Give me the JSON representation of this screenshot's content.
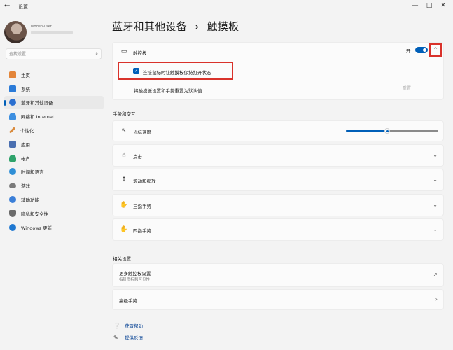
{
  "window": {
    "title": "设置",
    "back_glyph": "←",
    "min_glyph": "—",
    "max_glyph": "□",
    "close_glyph": "✕"
  },
  "profile": {
    "name": "hidden-user"
  },
  "search": {
    "placeholder": "查找设置",
    "icon": "search-icon"
  },
  "sidebar": {
    "active_index": 2,
    "items": [
      {
        "label": "主页",
        "icon": "home-icon",
        "color": "#e3853a"
      },
      {
        "label": "系统",
        "icon": "monitor-icon",
        "color": "#2b7bd8"
      },
      {
        "label": "蓝牙和其他设备",
        "icon": "bluetooth-icon",
        "color": "#2a6fd0"
      },
      {
        "label": "网络和 Internet",
        "icon": "wifi-icon",
        "color": "#3d8fe0"
      },
      {
        "label": "个性化",
        "icon": "brush-icon",
        "color": "#d98a3c"
      },
      {
        "label": "应用",
        "icon": "apps-icon",
        "color": "#4a6fb0"
      },
      {
        "label": "帐户",
        "icon": "person-icon",
        "color": "#2fa36b"
      },
      {
        "label": "时间和语言",
        "icon": "globe-clock-icon",
        "color": "#2f8fd6"
      },
      {
        "label": "游戏",
        "icon": "gamepad-icon",
        "color": "#7a7a7a"
      },
      {
        "label": "辅助功能",
        "icon": "accessibility-icon",
        "color": "#3b7fd8"
      },
      {
        "label": "隐私和安全性",
        "icon": "shield-icon",
        "color": "#6b6b6b"
      },
      {
        "label": "Windows 更新",
        "icon": "update-icon",
        "color": "#1f78d1"
      }
    ]
  },
  "header": {
    "breadcrumb_parent": "蓝牙和其他设备",
    "separator": "›",
    "title": "触摸板"
  },
  "touchpad": {
    "label": "触控板",
    "toggle_state_label": "开",
    "toggle_on": true,
    "collapse_glyph": "^",
    "checkbox_label": "连接鼠标时让触摸板保持打开状态",
    "checkbox_checked": true,
    "reset_label": "将触摸板设置和手势重置为默认值",
    "reset_button": "重置"
  },
  "gestures": {
    "section_title": "手势和交互",
    "cursor_speed_label": "光标速度",
    "cursor_speed_value": 0.45,
    "rows": [
      {
        "label": "点击",
        "icon": "tap-icon"
      },
      {
        "label": "滚动和缩放",
        "icon": "scroll-zoom-icon"
      },
      {
        "label": "三指手势",
        "icon": "three-finger-icon"
      },
      {
        "label": "四指手势",
        "icon": "four-finger-icon"
      }
    ]
  },
  "related": {
    "section_title": "相关设置",
    "more_settings_label": "更多触控板设置",
    "more_settings_sub": "指针图标和可见性",
    "advanced_gestures_label": "高级手势"
  },
  "help": {
    "get_help": "获取帮助",
    "feedback": "提供反馈"
  },
  "colors": {
    "accent": "#005fb8",
    "highlight_box": "#d9322b"
  }
}
